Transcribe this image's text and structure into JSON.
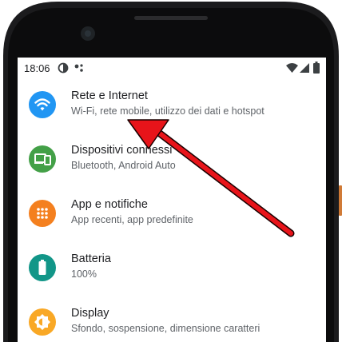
{
  "status_bar": {
    "time": "18:06",
    "icons": [
      "data-saver-icon",
      "assistant-dots-icon",
      "wifi-icon",
      "signal-icon",
      "battery-icon"
    ]
  },
  "settings_items": [
    {
      "title": "Rete e Internet",
      "subtitle": "Wi-Fi, rete mobile, utilizzo dei dati e hotspot",
      "icon": "wifi-icon",
      "color": "#2196F3"
    },
    {
      "title": "Dispositivi connessi",
      "subtitle": "Bluetooth, Android Auto",
      "icon": "devices-icon",
      "color": "#43A047"
    },
    {
      "title": "App e notifiche",
      "subtitle": "App recenti, app predefinite",
      "icon": "apps-grid-icon",
      "color": "#F4801F"
    },
    {
      "title": "Batteria",
      "subtitle": "100%",
      "icon": "battery-icon",
      "color": "#129688"
    },
    {
      "title": "Display",
      "subtitle": "Sfondo, sospensione, dimensione caratteri",
      "icon": "brightness-icon",
      "color": "#F9A825"
    }
  ],
  "annotation": {
    "arrow_color": "#E8141A"
  }
}
